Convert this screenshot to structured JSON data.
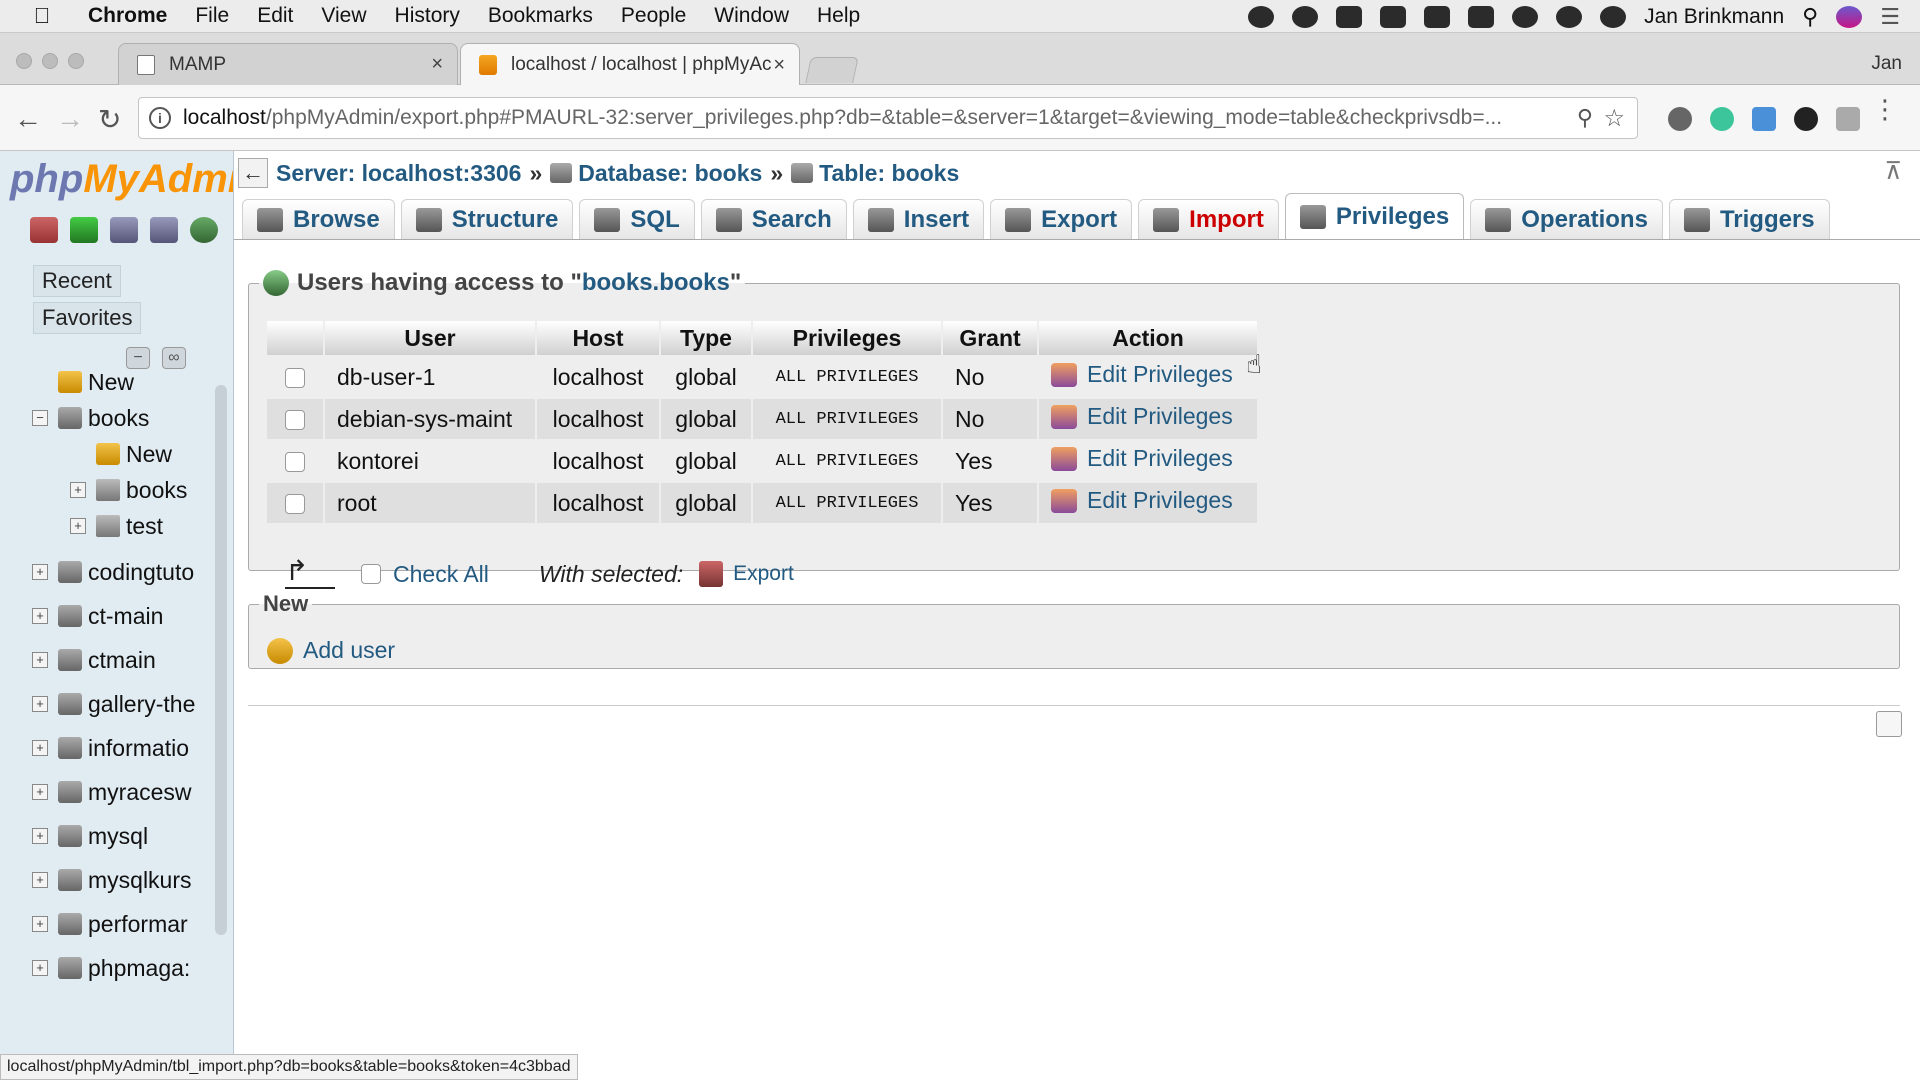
{
  "menubar": {
    "app_name": "Chrome",
    "items": [
      "File",
      "Edit",
      "View",
      "History",
      "Bookmarks",
      "People",
      "Window",
      "Help"
    ],
    "user_name": "Jan Brinkmann"
  },
  "tabs": [
    {
      "title": "MAMP",
      "close": "×"
    },
    {
      "title": "localhost / localhost | phpMyAc",
      "close": "×"
    }
  ],
  "profile_name": "Jan",
  "address_bar": {
    "host": "localhost",
    "path": "/phpMyAdmin/export.php#PMAURL-32:server_privileges.php?db=&table=&server=1&target=&viewing_mode=table&checkprivsdb=..."
  },
  "sidebar": {
    "logo": {
      "php": "php",
      "my": "My",
      "admin": "Admi"
    },
    "recent_label": "Recent",
    "favorites_label": "Favorites",
    "tree": [
      {
        "label": "New",
        "level": 0,
        "kind": "new"
      },
      {
        "label": "books",
        "level": 0,
        "kind": "db",
        "expander": "−"
      },
      {
        "label": "New",
        "level": 1,
        "kind": "new"
      },
      {
        "label": "books",
        "level": 1,
        "kind": "table",
        "expander": "+"
      },
      {
        "label": "test",
        "level": 1,
        "kind": "table",
        "expander": "+"
      },
      {
        "label": "codingtuto",
        "level": 0,
        "kind": "db",
        "expander": "+"
      },
      {
        "label": "ct-main",
        "level": 0,
        "kind": "db",
        "expander": "+"
      },
      {
        "label": "ctmain",
        "level": 0,
        "kind": "db",
        "expander": "+"
      },
      {
        "label": "gallery-the",
        "level": 0,
        "kind": "db",
        "expander": "+"
      },
      {
        "label": "informatio",
        "level": 0,
        "kind": "db",
        "expander": "+"
      },
      {
        "label": "myracesw",
        "level": 0,
        "kind": "db",
        "expander": "+"
      },
      {
        "label": "mysql",
        "level": 0,
        "kind": "db",
        "expander": "+"
      },
      {
        "label": "mysqlkurs",
        "level": 0,
        "kind": "db",
        "expander": "+"
      },
      {
        "label": "performar",
        "level": 0,
        "kind": "db",
        "expander": "+"
      },
      {
        "label": "phpmaga:",
        "level": 0,
        "kind": "db",
        "expander": "+"
      }
    ]
  },
  "breadcrumb": {
    "back": "←",
    "server": "Server: localhost:3306",
    "database": "Database: books",
    "table": "Table: books",
    "sep": "»"
  },
  "nav_tabs": [
    {
      "label": "Browse",
      "name": "tab-browse"
    },
    {
      "label": "Structure",
      "name": "tab-structure"
    },
    {
      "label": "SQL",
      "name": "tab-sql"
    },
    {
      "label": "Search",
      "name": "tab-search"
    },
    {
      "label": "Insert",
      "name": "tab-insert"
    },
    {
      "label": "Export",
      "name": "tab-export"
    },
    {
      "label": "Import",
      "name": "tab-import"
    },
    {
      "label": "Privileges",
      "name": "tab-privileges"
    },
    {
      "label": "Operations",
      "name": "tab-operations"
    },
    {
      "label": "Triggers",
      "name": "tab-triggers"
    }
  ],
  "active_tab": "Privileges",
  "users_box": {
    "legend_prefix": "Users having access to \"",
    "legend_db": "books.books",
    "legend_suffix": "\"",
    "columns": [
      "",
      "User",
      "Host",
      "Type",
      "Privileges",
      "Grant",
      "Action"
    ],
    "rows": [
      {
        "user": "db-user-1",
        "host": "localhost",
        "type": "global",
        "privileges": "ALL PRIVILEGES",
        "grant": "No",
        "action": "Edit Privileges"
      },
      {
        "user": "debian-sys-maint",
        "host": "localhost",
        "type": "global",
        "privileges": "ALL PRIVILEGES",
        "grant": "No",
        "action": "Edit Privileges"
      },
      {
        "user": "kontorei",
        "host": "localhost",
        "type": "global",
        "privileges": "ALL PRIVILEGES",
        "grant": "Yes",
        "action": "Edit Privileges"
      },
      {
        "user": "root",
        "host": "localhost",
        "type": "global",
        "privileges": "ALL PRIVILEGES",
        "grant": "Yes",
        "action": "Edit Privileges"
      }
    ],
    "check_all": "Check All",
    "with_selected": "With selected:",
    "export": "Export"
  },
  "new_box": {
    "legend": "New",
    "add_user": "Add user"
  },
  "status_url": "localhost/phpMyAdmin/tbl_import.php?db=books&table=books&token=4c3bbad",
  "colors": {
    "link": "#235a81",
    "sidebar_bg": "#e0ebf2",
    "import_tab": "#cc0000",
    "logo_orange": "#f89406",
    "logo_blue": "#6c78af"
  }
}
